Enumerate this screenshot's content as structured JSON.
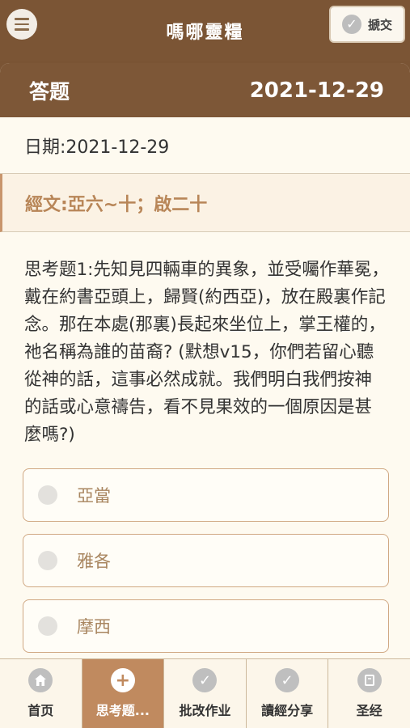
{
  "header": {
    "menu_icon": "hamburger-menu-icon",
    "title": "嗎哪靈糧",
    "submit_label": "搋交",
    "submit_icon": "check-circle-icon"
  },
  "panel": {
    "title": "答题",
    "date": "2021-12-29"
  },
  "date_line": "日期:2021-12-29",
  "scripture": "經文:亞六~十；啟二十",
  "question": "思考题1:先知見四輛車的異象，並受囑作華冕，戴在約書亞頭上，歸賢(約西亞)，放在殿裏作記念。那在本處(那裏)長起來坐位上，掌王權的，祂名稱為誰的苗裔? (默想v15，你們若留心聽從神的話，這事必然成就。我們明白我們按神的話或心意禱告，看不見果效的一個原因是甚麼嗎?)",
  "options": [
    {
      "label": "亞當"
    },
    {
      "label": "雅各"
    },
    {
      "label": "摩西"
    }
  ],
  "tabs": [
    {
      "label": "首页",
      "icon": "home-icon"
    },
    {
      "label": "思考题...",
      "icon": "plus-icon"
    },
    {
      "label": "批改作业",
      "icon": "check-icon"
    },
    {
      "label": "讀經分享",
      "icon": "check-icon"
    },
    {
      "label": "圣经",
      "icon": "book-icon"
    }
  ],
  "colors": {
    "brand_brown": "#7b5535",
    "accent_tan": "#c08a5f",
    "background": "#fefaf0"
  }
}
